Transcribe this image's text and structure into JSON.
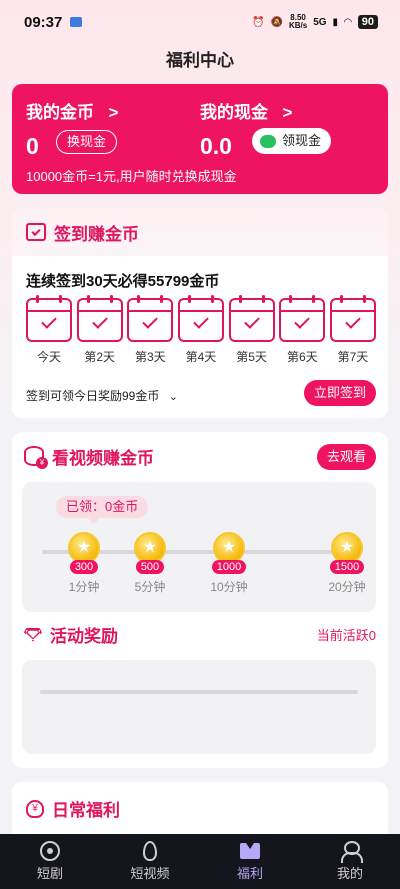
{
  "status_bar": {
    "time": "09:37",
    "speed_value": "8.50",
    "speed_unit": "KB/s",
    "network": "5G",
    "battery": "90"
  },
  "header": {
    "title": "福利中心"
  },
  "coins_card": {
    "my_coins_label": "我的金币",
    "my_coins_arrow": ">",
    "coins_value": "0",
    "exchange_button": "换现金",
    "my_cash_label": "我的现金",
    "my_cash_arrow": ">",
    "cash_value": "0.0",
    "claim_cash_button": "领现金",
    "note": "10000金币=1元,用户随时兑换成现金"
  },
  "signin": {
    "title": "签到赚金币",
    "streak_text": "连续签到30天必得55799金币",
    "days": [
      "今天",
      "第2天",
      "第3天",
      "第4天",
      "第5天",
      "第6天",
      "第7天"
    ],
    "reward_text": "签到可领今日奖励99金币",
    "expand_icon": "chevron-down",
    "signin_button": "立即签到"
  },
  "video": {
    "title": "看视频赚金币",
    "watch_button": "去观看",
    "claimed_text": "已领：0金币",
    "progress": 0,
    "milestones": [
      {
        "coins": "300",
        "time": "1分钟"
      },
      {
        "coins": "500",
        "time": "5分钟"
      },
      {
        "coins": "1000",
        "time": "10分钟"
      },
      {
        "coins": "1500",
        "time": "20分钟"
      }
    ]
  },
  "activity": {
    "title": "活动奖励",
    "current_active": "当前活跃0"
  },
  "daily": {
    "title": "日常福利",
    "icon": "¥"
  },
  "tabbar": {
    "items": [
      {
        "label": "短剧"
      },
      {
        "label": "短视频"
      },
      {
        "label": "福利"
      },
      {
        "label": "我的"
      }
    ],
    "active_index": 2
  },
  "colors": {
    "accent": "#ee1462",
    "tab_active": "#b7a8f5",
    "tabbar_bg": "#15151d"
  }
}
